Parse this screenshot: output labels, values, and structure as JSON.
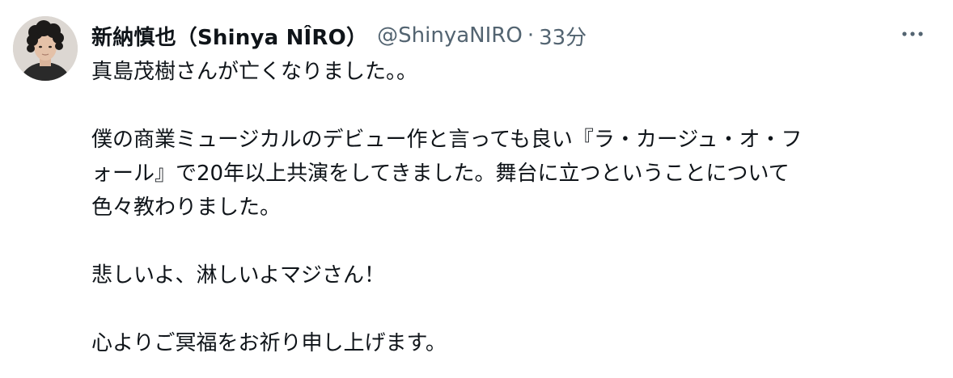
{
  "tweet": {
    "display_name": "新納慎也（Shinya NÎRO）",
    "handle": "@ShinyaNIRO",
    "separator": "·",
    "time": "33分",
    "more_icon": "more-horizontal-icon",
    "lines": [
      "真島茂樹さんが亡くなりました。。",
      "",
      "僕の商業ミュージカルのデビュー作と言っても良い『ラ・カージュ・オ・フ",
      "ォール』で20年以上共演をしてきました。舞台に立つということについて",
      "色々教わりました。",
      "",
      "悲しいよ、淋しいよマジさん！",
      "",
      "心よりご冥福をお祈り申し上げます。"
    ]
  },
  "colors": {
    "primary_text": "#0f1419",
    "secondary_text": "#536471"
  }
}
